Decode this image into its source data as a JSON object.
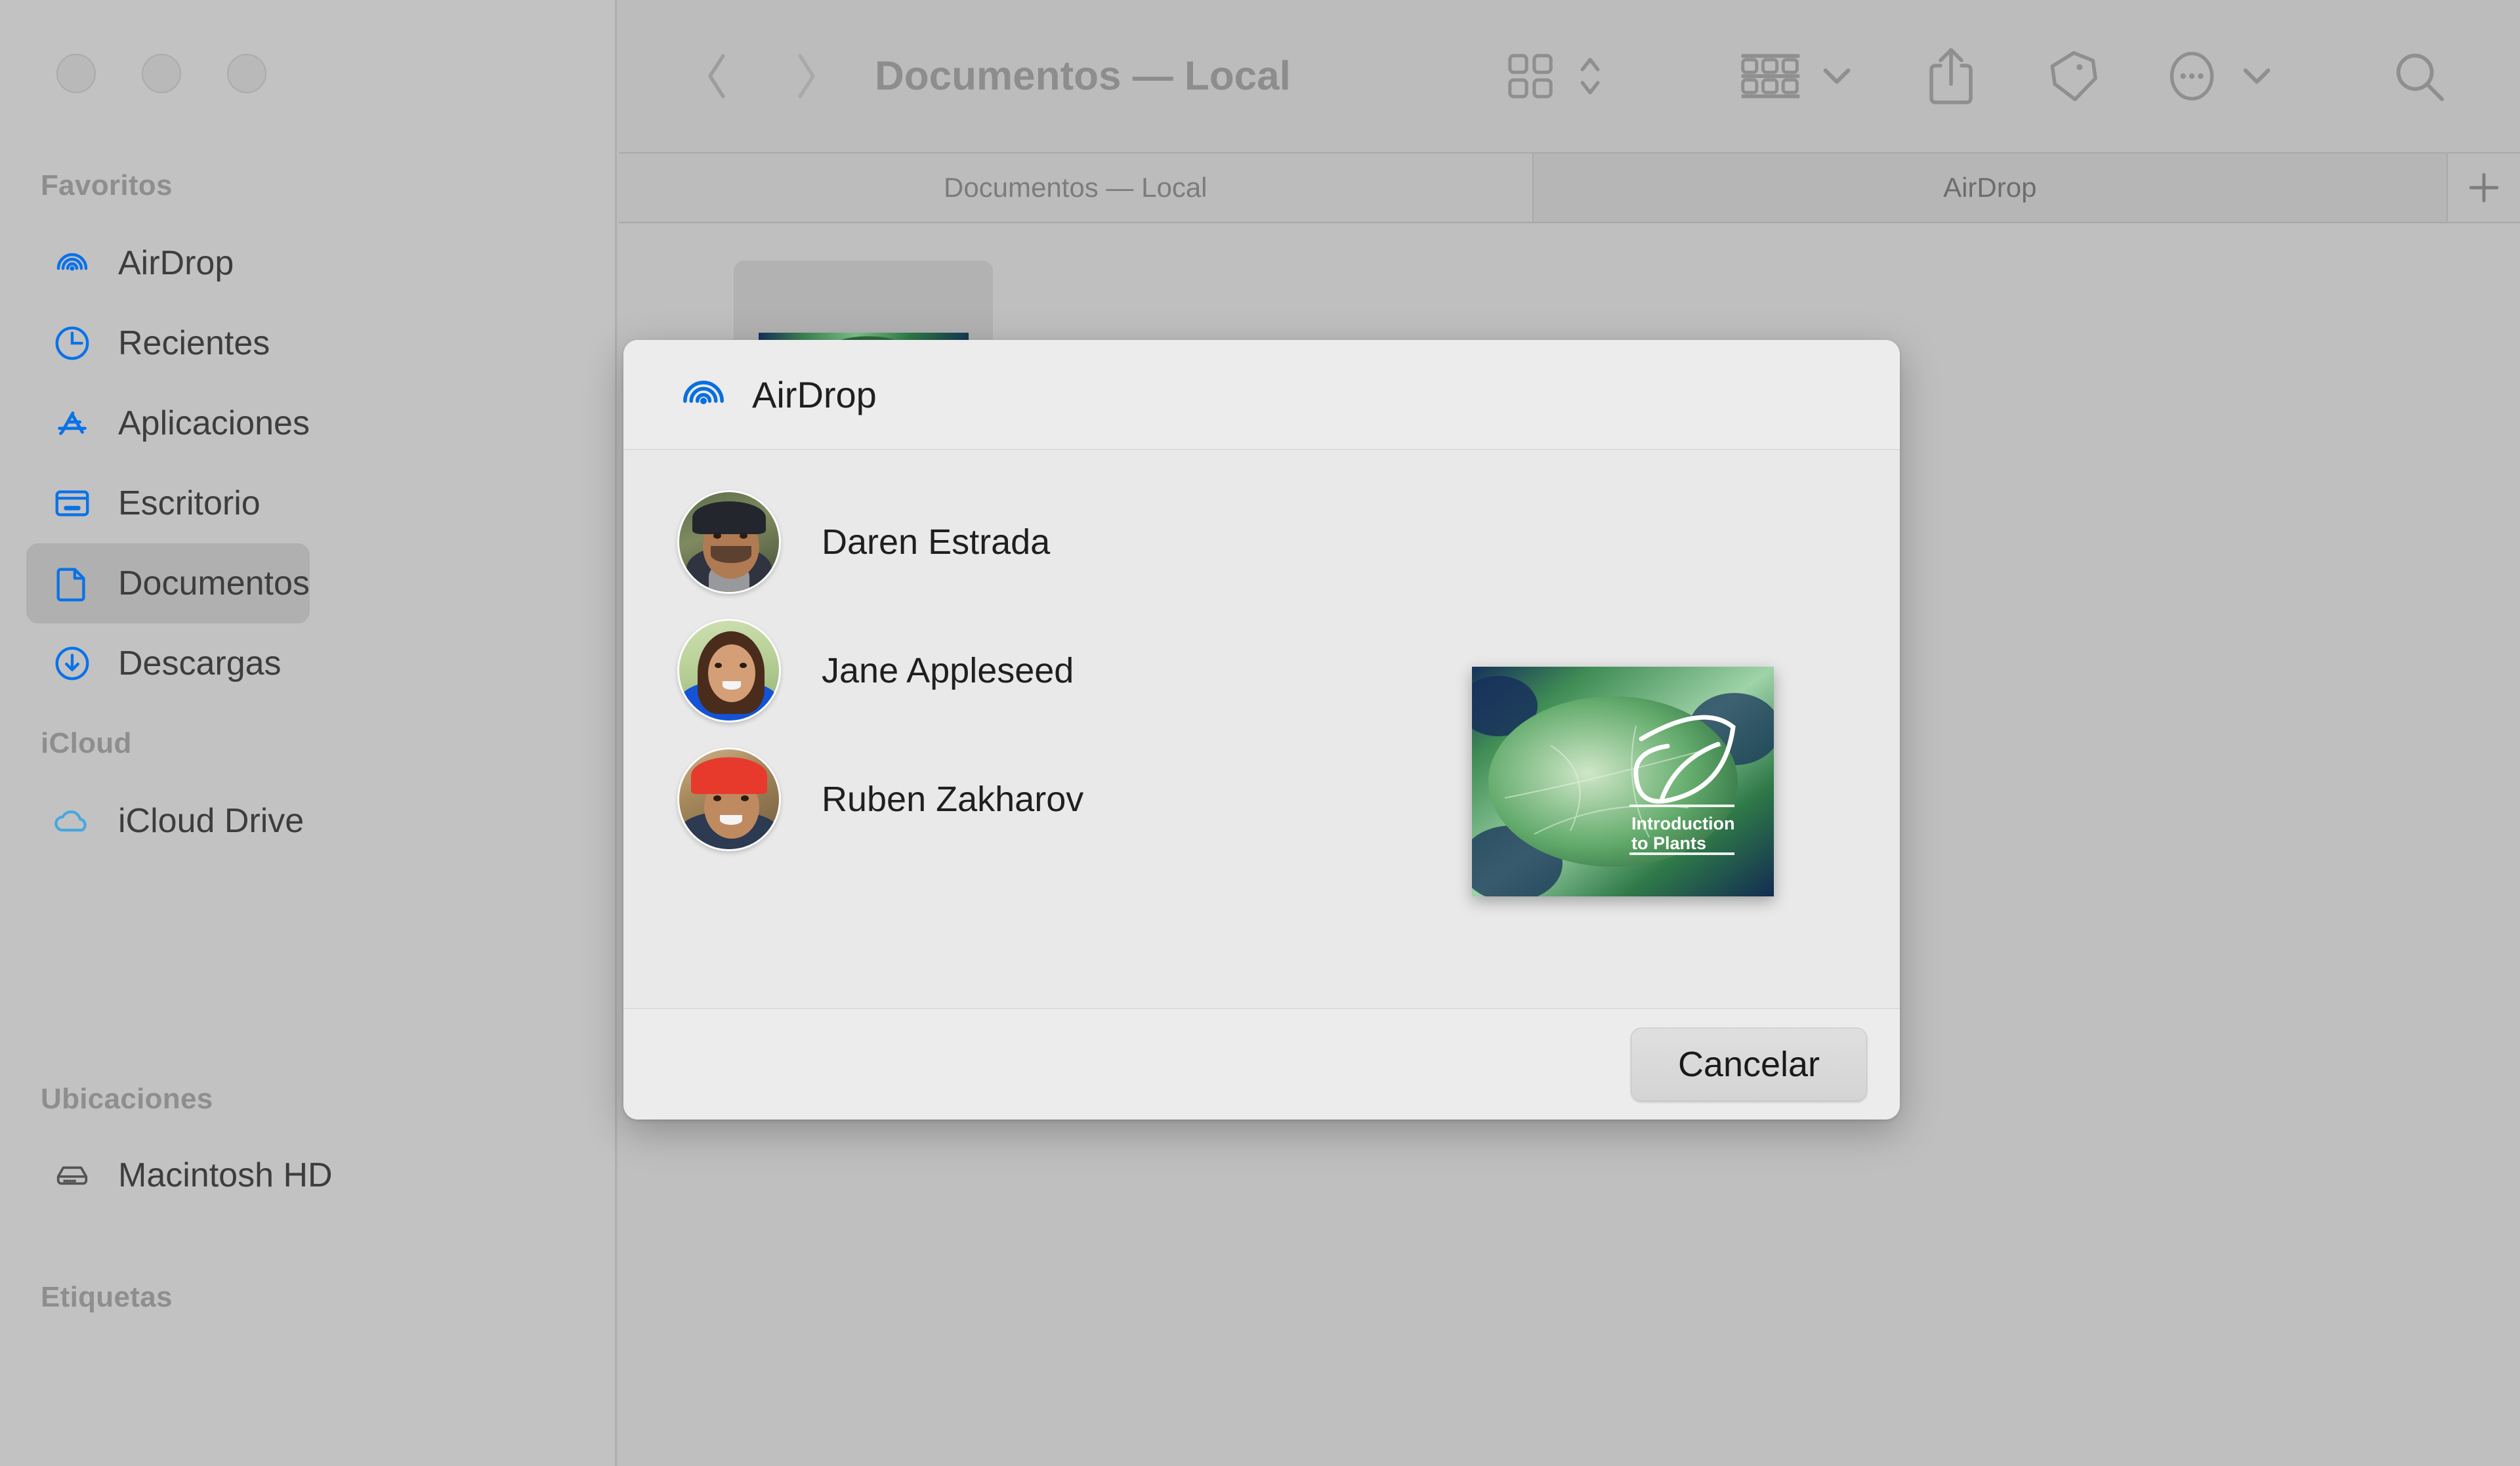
{
  "window": {
    "title": "Documentos — Local",
    "traffic_lights": [
      "close",
      "minimize",
      "zoom"
    ]
  },
  "sidebar": {
    "sections": [
      {
        "header": "Favoritos",
        "items": [
          {
            "label": "AirDrop",
            "icon": "airdrop-icon",
            "selected": false
          },
          {
            "label": "Recientes",
            "icon": "clock-icon",
            "selected": false
          },
          {
            "label": "Aplicaciones",
            "icon": "app-store-icon",
            "selected": false
          },
          {
            "label": "Escritorio",
            "icon": "desktop-icon",
            "selected": false
          },
          {
            "label": "Documentos",
            "icon": "document-icon",
            "selected": true
          },
          {
            "label": "Descargas",
            "icon": "download-icon",
            "selected": false
          }
        ]
      },
      {
        "header": "iCloud",
        "items": [
          {
            "label": "iCloud Drive",
            "icon": "cloud-icon",
            "selected": false
          }
        ]
      },
      {
        "header": "Ubicaciones",
        "items": [
          {
            "label": "Macintosh HD",
            "icon": "hard-drive-icon",
            "selected": false
          }
        ]
      },
      {
        "header": "Etiquetas",
        "items": []
      }
    ]
  },
  "toolbar": {
    "back": "back-icon",
    "forward": "forward-icon",
    "title": "Documentos — Local",
    "view_grid": "grid-view-icon",
    "view_chevron": "updown-chevron-icon",
    "group_by": "group-by-icon",
    "group_chevron": "chevron-down-icon",
    "share": "share-icon",
    "tag": "tag-icon",
    "more": "more-ellipsis-icon",
    "more_chevron": "chevron-down-icon",
    "search": "search-icon"
  },
  "tabbar": {
    "tabs": [
      {
        "label": "Documentos — Local",
        "active": false
      },
      {
        "label": "AirDrop",
        "active": true
      }
    ],
    "add_label": "+"
  },
  "dialog": {
    "icon": "airdrop-icon",
    "title": "AirDrop",
    "contacts": [
      {
        "name": "Daren Estrada",
        "avatar": "avatar-daren"
      },
      {
        "name": "Jane Appleseed",
        "avatar": "avatar-jane"
      },
      {
        "name": "Ruben Zakharov",
        "avatar": "avatar-ruben"
      }
    ],
    "dragged_file": {
      "thumbnail_title": "Introduction",
      "thumbnail_subtitle": "to Plants",
      "thumbnail_icon": "leaf-icon"
    },
    "cancel_label": "Cancelar"
  },
  "colors": {
    "accent_blue": "#0a72e8",
    "window_chrome": "#bcbcbc",
    "sidebar": "#c2c2c2",
    "sidebar_selected": "#b0b0b0",
    "dialog_bg": "#ececec",
    "dialog_body": "#e9e9e9",
    "text_primary": "#1f1f1f",
    "text_secondary": "#8e8e8e"
  }
}
